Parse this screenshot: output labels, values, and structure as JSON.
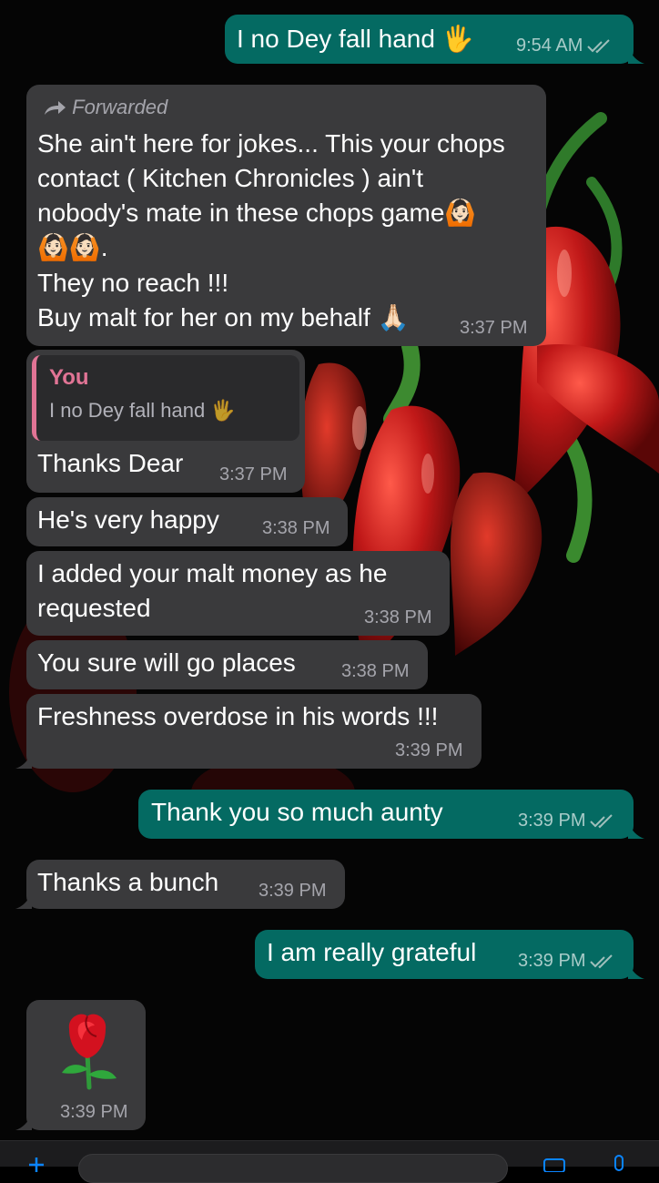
{
  "messages": [
    {
      "dir": "out",
      "text": "I no Dey fall hand 🖐",
      "time": "9:54 AM"
    },
    {
      "dir": "in",
      "forwarded": "Forwarded",
      "lines": [
        "She ain't here for jokes... This your chops",
        "contact ( Kitchen Chronicles ) ain't",
        "nobody's mate in these chops game🙆🏻",
        "🙆🏻🙆🏻.",
        "They no reach !!!",
        "Buy malt for her on my behalf 🙏🏻"
      ],
      "time": "3:37 PM"
    },
    {
      "dir": "in",
      "quote_author": "You",
      "quote_text": "I no Dey fall hand 🖐",
      "text": "Thanks Dear",
      "time": "3:37 PM"
    },
    {
      "dir": "in",
      "text": "He's very happy",
      "time": "3:38 PM"
    },
    {
      "dir": "in",
      "lines": [
        "I added your malt money as he",
        "requested"
      ],
      "time": "3:38 PM"
    },
    {
      "dir": "in",
      "text": "You sure will go places",
      "time": "3:38 PM"
    },
    {
      "dir": "in",
      "text": "Freshness overdose in his words !!!",
      "time": "3:39 PM"
    },
    {
      "dir": "out",
      "text": "Thank you so much aunty",
      "time": "3:39 PM"
    },
    {
      "dir": "in",
      "text": "Thanks a bunch",
      "time": "3:39 PM"
    },
    {
      "dir": "out",
      "text": "I am really grateful",
      "time": "3:39 PM"
    },
    {
      "dir": "in",
      "emoji": "🌹",
      "time": "3:39 PM"
    }
  ],
  "icons": {
    "forward": "forward-arrow-icon",
    "read": "double-check-icon"
  },
  "colors": {
    "incoming": "#3a3a3c",
    "outgoing": "#046a62",
    "read_ticks": "#8fd0c8",
    "quote_accent": "#e17495"
  }
}
